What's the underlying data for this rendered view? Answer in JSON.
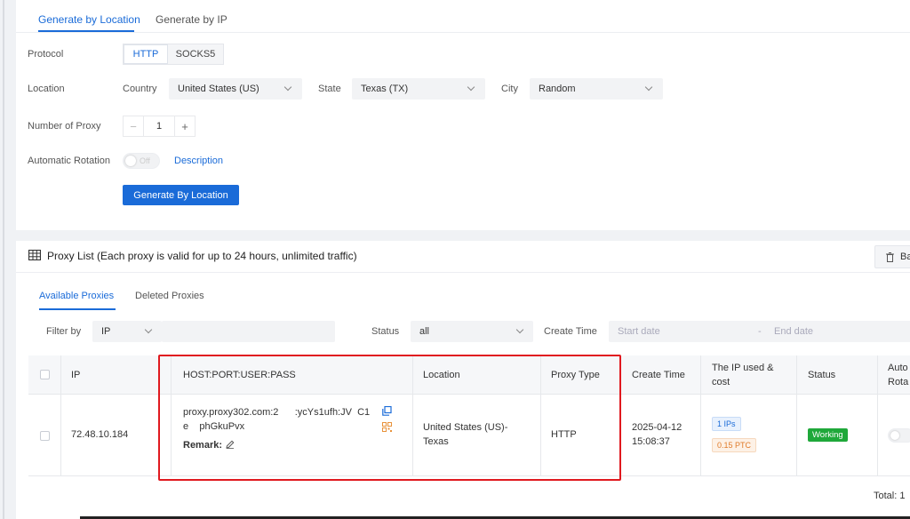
{
  "tabs_top": [
    "Generate by Location",
    "Generate by IP"
  ],
  "protocol": {
    "label": "Protocol",
    "options": [
      "HTTP",
      "SOCKS5"
    ],
    "selected": "HTTP"
  },
  "location": {
    "label": "Location",
    "country_label": "Country",
    "country_value": "United States (US)",
    "state_label": "State",
    "state_value": "Texas (TX)",
    "city_label": "City",
    "city_value": "Random"
  },
  "number_of_proxy": {
    "label": "Number of Proxy",
    "minus": "−",
    "value": "1",
    "plus": "+"
  },
  "rotation": {
    "label": "Automatic Rotation",
    "toggle_text": "Off",
    "description_link": "Description"
  },
  "generate_button": "Generate By Location",
  "proxy_list": {
    "title": "Proxy List (Each proxy is valid for up to 24 hours, unlimited traffic)",
    "batch_button": "Ba",
    "tabs": [
      "Available Proxies",
      "Deleted Proxies"
    ],
    "filter_label": "Filter by",
    "filter_value": "IP",
    "status_label": "Status",
    "status_value": "all",
    "create_time_label": "Create Time",
    "start_placeholder": "Start date",
    "range_sep": "-",
    "end_placeholder": "End date",
    "columns": [
      "IP",
      "HOST:PORT:USER:PASS",
      "Location",
      "Proxy Type",
      "Create Time",
      "The IP used &",
      "cost",
      "Status",
      "Auto",
      "Rota"
    ],
    "row": {
      "ip": "72.48.10.184",
      "cred_line1": "proxy.proxy302.com:2   :ycYs1ufh:JV C1",
      "cred_line2": "e  phGkuPvx",
      "remark": "Remark:",
      "location_line1": "United States (US)-",
      "location_line2": "Texas",
      "proxy_type": "HTTP",
      "date": "2025-04-12",
      "time": "15:08:37",
      "ips_badge": "1 IPs",
      "cost_badge": "0.15 PTC",
      "status": "Working"
    },
    "total": "Total: 1"
  },
  "colors": {
    "primary": "#1a6bd8",
    "working": "#1fa83a",
    "highlight": "#e0191f"
  }
}
